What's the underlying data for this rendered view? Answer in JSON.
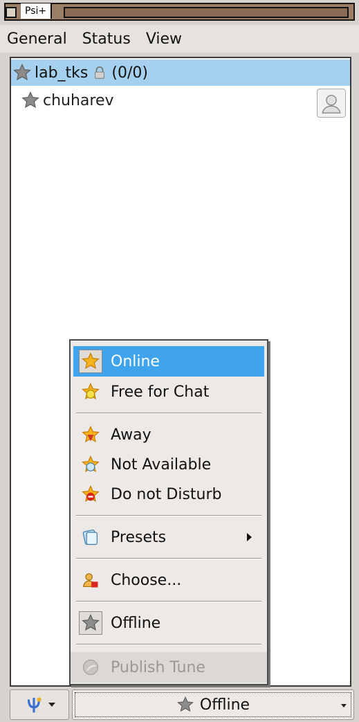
{
  "window": {
    "title": "Psi+"
  },
  "menubar": {
    "items": [
      "General",
      "Status",
      "View"
    ]
  },
  "roster": {
    "account": {
      "name": "lab_tks",
      "counts": "(0/0)"
    },
    "contacts": [
      {
        "name": "chuharev"
      }
    ]
  },
  "status_menu": {
    "items": [
      {
        "label": "Online",
        "icon": "star-online-icon"
      },
      {
        "label": "Free for Chat",
        "icon": "star-chat-icon"
      },
      {
        "label": "Away",
        "icon": "star-away-icon"
      },
      {
        "label": "Not Available",
        "icon": "star-na-icon"
      },
      {
        "label": "Do not Disturb",
        "icon": "star-dnd-icon"
      },
      {
        "label": "Presets",
        "icon": "presets-icon"
      },
      {
        "label": "Choose...",
        "icon": "choose-icon"
      },
      {
        "label": "Offline",
        "icon": "star-offline-icon"
      },
      {
        "label": "Publish Tune",
        "icon": "tune-icon"
      }
    ]
  },
  "bottombar": {
    "status_value": "Offline"
  },
  "colors": {
    "selection": "#3fa4ec",
    "account_row": "#a5d1ee"
  }
}
